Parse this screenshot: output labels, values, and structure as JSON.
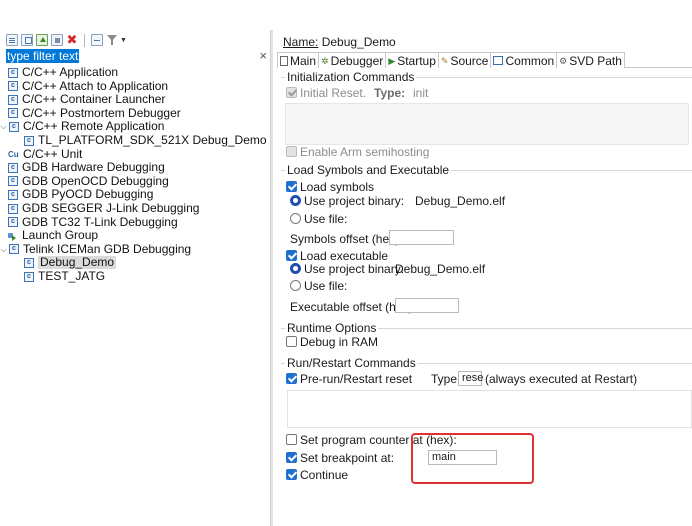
{
  "filter": {
    "value": "type filter text",
    "clear": "×"
  },
  "tree": [
    {
      "id": "cpp-app",
      "label": "C/C++ Application",
      "icon": "c-config-icon",
      "indent": 0
    },
    {
      "id": "cpp-attach",
      "label": "C/C++ Attach to Application",
      "icon": "c-config-icon",
      "indent": 0
    },
    {
      "id": "cpp-container",
      "label": "C/C++ Container Launcher",
      "icon": "c-config-icon",
      "indent": 0
    },
    {
      "id": "cpp-postmortem",
      "label": "C/C++ Postmortem Debugger",
      "icon": "c-config-icon",
      "indent": 0
    },
    {
      "id": "cpp-remote",
      "label": "C/C++ Remote Application",
      "icon": "c-config-icon",
      "indent": 0,
      "expanded": true
    },
    {
      "id": "tl-platform",
      "label": "TL_PLATFORM_SDK_521X Debug_Demo",
      "icon": "c-config-icon",
      "indent": 1
    },
    {
      "id": "cpp-unit",
      "label": "C/C++ Unit",
      "icon": "cu-icon",
      "indent": 0,
      "icon_text": "Cu"
    },
    {
      "id": "gdb-hw",
      "label": "GDB Hardware Debugging",
      "icon": "c-config-icon",
      "indent": 0
    },
    {
      "id": "gdb-openocd",
      "label": "GDB OpenOCD Debugging",
      "icon": "c-config-icon",
      "indent": 0
    },
    {
      "id": "gdb-pyocd",
      "label": "GDB PyOCD Debugging",
      "icon": "c-config-icon",
      "indent": 0
    },
    {
      "id": "gdb-jlink",
      "label": "GDB SEGGER J-Link Debugging",
      "icon": "c-config-icon",
      "indent": 0
    },
    {
      "id": "gdb-tc32",
      "label": "GDB TC32 T-Link Debugging",
      "icon": "c-config-icon",
      "indent": 0
    },
    {
      "id": "launch-group",
      "label": "Launch Group",
      "icon": "launch-group-icon",
      "indent": 0
    },
    {
      "id": "telink",
      "label": "Telink ICEMan GDB Debugging",
      "icon": "c-config-icon",
      "indent": 0,
      "expanded": true
    },
    {
      "id": "debug-demo",
      "label": "Debug_Demo",
      "icon": "c-config-icon",
      "indent": 1,
      "selected": true
    },
    {
      "id": "test-jatg",
      "label": "TEST_JATG",
      "icon": "c-config-icon",
      "indent": 1
    }
  ],
  "config": {
    "name_label": "Name:",
    "name_value": "Debug_Demo",
    "tabs": [
      "Main",
      "Debugger",
      "Startup",
      "Source",
      "Common",
      "SVD Path"
    ],
    "active_tab": "Startup"
  },
  "init": {
    "title": "Initialization Commands",
    "initial_reset_label": "Initial Reset.",
    "type_label": "Type:",
    "type_value": "init",
    "arm_semihosting_label": "Enable Arm semihosting"
  },
  "symbols": {
    "title": "Load Symbols and Executable",
    "load_symbols_label": "Load symbols",
    "use_project_binary_label": "Use project binary:",
    "symbols_binary_value": "Debug_Demo.elf",
    "use_file_label": "Use file:",
    "symbols_offset_label": "Symbols offset (hex):",
    "load_executable_label": "Load executable",
    "executable_binary_value": "Debug_Demo.elf",
    "executable_offset_label": "Executable offset (hex):"
  },
  "runtime": {
    "title": "Runtime Options",
    "debug_in_ram_label": "Debug in RAM"
  },
  "run_restart": {
    "title": "Run/Restart Commands",
    "pre_run_label": "Pre-run/Restart reset",
    "type_label": "Type:",
    "type_value": "rese",
    "always_note": "(always executed at Restart)",
    "set_pc_label": "Set program counter at (hex):",
    "set_breakpoint_label": "Set breakpoint at:",
    "breakpoint_value": "main",
    "continue_label": "Continue"
  },
  "colors": {
    "accent": "#1f6fcf",
    "selection": "#0078d7",
    "highlight": "#e03232"
  }
}
